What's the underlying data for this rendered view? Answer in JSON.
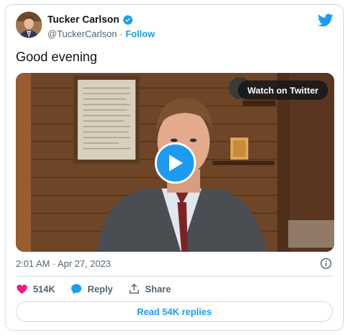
{
  "tweet": {
    "author": {
      "display_name": "Tucker Carlson",
      "handle": "@TuckerCarlson",
      "separator": "·",
      "follow_label": "Follow",
      "verified_icon": "verified-badge-icon"
    },
    "text": "Good evening",
    "media": {
      "watch_label": "Watch on Twitter",
      "play_icon": "play-icon"
    },
    "timestamp": "2:01 AM · Apr 27, 2023",
    "actions": {
      "like_count": "514K",
      "reply_label": "Reply",
      "share_label": "Share"
    },
    "read_replies_label": "Read 54K replies"
  },
  "colors": {
    "accent": "#1d9bf0",
    "like": "#f91880",
    "text_primary": "#0f1419",
    "text_secondary": "#536471",
    "border": "#cfd9de"
  }
}
